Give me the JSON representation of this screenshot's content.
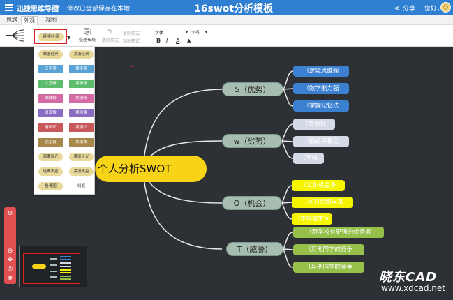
{
  "topbar": {
    "app_name": "迅捷思维导图",
    "save_status": "修改已全部保存在本地",
    "title": "16swot分析模板",
    "share": "分享",
    "greeting": "您好，",
    "menu_icon": "menu-icon",
    "share_icon": "share-icon"
  },
  "tabs": [
    "思路",
    "外观",
    "视图"
  ],
  "toolbar": {
    "style_value": "紧凑经典",
    "layout_label": "整理布局",
    "clear_label": "清除样式",
    "copy_label": "复制样式",
    "paste_label": "粘贴样式",
    "font_label": "字体",
    "size_label": "字号",
    "bold": "B",
    "italic": "I",
    "font_color": "A",
    "bg_color": "▲"
  },
  "style_menu": {
    "items": [
      {
        "label": "脑图经典",
        "color": "#e8d99a",
        "shape": "pill"
      },
      {
        "label": "紧凑经典",
        "color": "#e8d99a",
        "shape": "pill"
      },
      {
        "label": "天空蓝",
        "color": "#5aa1d6",
        "shape": "box"
      },
      {
        "label": "紧凑蓝",
        "color": "#5aa1d6",
        "shape": "box"
      },
      {
        "label": "文艺绿",
        "color": "#5dbb6c",
        "shape": "box"
      },
      {
        "label": "紧凑绿",
        "color": "#5dbb6c",
        "shape": "box"
      },
      {
        "label": "脑残粉",
        "color": "#d46ba5",
        "shape": "box"
      },
      {
        "label": "紧凑粉",
        "color": "#d46ba5",
        "shape": "box"
      },
      {
        "label": "浪漫紫",
        "color": "#8a6cc0",
        "shape": "box"
      },
      {
        "label": "紧凑紫",
        "color": "#8a6cc0",
        "shape": "box"
      },
      {
        "label": "清新红",
        "color": "#c9585a",
        "shape": "box"
      },
      {
        "label": "紧凑红",
        "color": "#c9585a",
        "shape": "box"
      },
      {
        "label": "泥土黄",
        "color": "#a8884a",
        "shape": "box"
      },
      {
        "label": "紧凑黄",
        "color": "#a8884a",
        "shape": "box"
      },
      {
        "label": "温柔冷光",
        "color": "#e8d99a",
        "shape": "pill"
      },
      {
        "label": "紧凑冷光",
        "color": "#e8d99a",
        "shape": "pill"
      },
      {
        "label": "经典天盘",
        "color": "#e8d99a",
        "shape": "pill"
      },
      {
        "label": "紧凑天盘",
        "color": "#e8d99a",
        "shape": "pill"
      },
      {
        "label": "鱼骨图",
        "color": "#e8d99a",
        "shape": "pill"
      },
      {
        "label": "线框",
        "color": "",
        "shape": "plain"
      }
    ]
  },
  "mindmap": {
    "root": "个人分析SWOT",
    "branches": [
      {
        "label": "S（优势）",
        "leaves": [
          "（逻辑思维强",
          "（数学能力强",
          "（掌握记忆法"
        ],
        "leaf_style": "blue"
      },
      {
        "label": "w（劣势）",
        "leaves": [
          "（情商低",
          "（情绪不稳定",
          "（不帅"
        ],
        "leaf_style": "grey"
      },
      {
        "label": "O（机会）",
        "leaves": [
          "（工作机会多",
          "（学习资源丰富",
          "（市场需求大"
        ],
        "leaf_style": "yellow"
      },
      {
        "label": "T（威胁）",
        "leaves": [
          "（新学校有更强的优秀者",
          "（其他同学的竞争",
          "（其他同学的竞争"
        ],
        "leaf_style": "green"
      }
    ]
  },
  "tools": {
    "zoom_in": "⊕",
    "zoom_out": "⊖",
    "move": "✥",
    "locate": "◎",
    "eye": "👁"
  },
  "watermark": {
    "logo": "晓东CAD",
    "url": "www.xdcad.net"
  }
}
